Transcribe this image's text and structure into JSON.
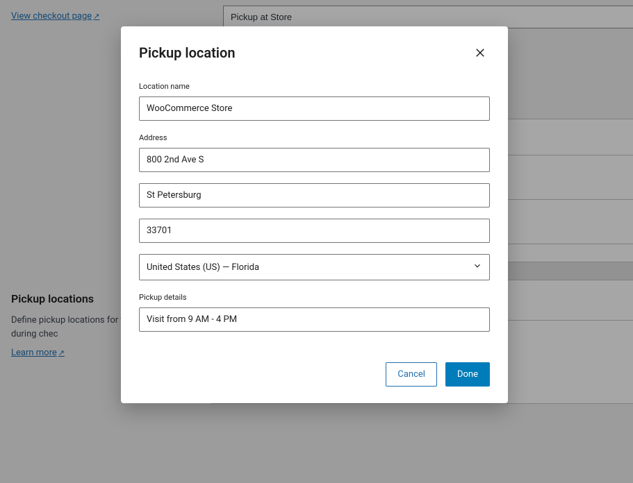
{
  "bg": {
    "checkout_link": "View checkout page",
    "pickup_input": "Pickup at Store",
    "section_title": "Pickup locations",
    "section_desc": "Define pickup locations for to choose from during chec",
    "learn_more": "Learn more"
  },
  "modal": {
    "title": "Pickup location",
    "location_name_label": "Location name",
    "location_name_value": "WooCommerce Store",
    "address_label": "Address",
    "address_line1": "800 2nd Ave S",
    "address_city": "St Petersburg",
    "address_zip": "33701",
    "address_region": "United States (US) — Florida",
    "pickup_details_label": "Pickup details",
    "pickup_details_value": "Visit from 9 AM - 4 PM",
    "cancel_label": "Cancel",
    "done_label": "Done"
  }
}
